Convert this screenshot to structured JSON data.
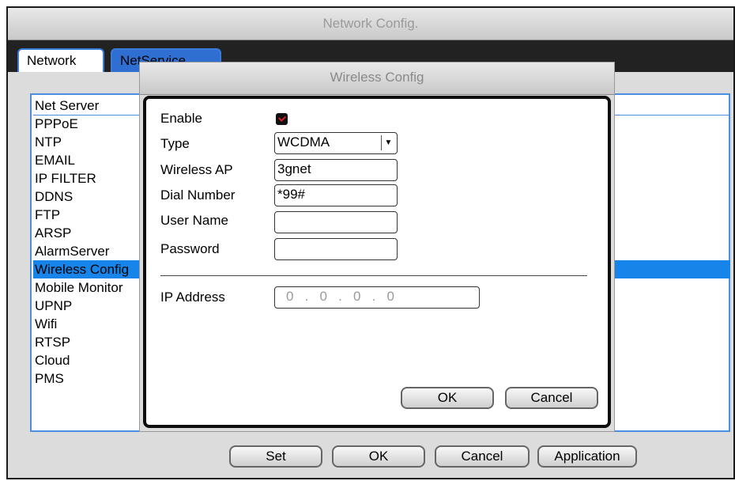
{
  "window": {
    "title": "Network Config."
  },
  "tabs": [
    {
      "label": "Network"
    },
    {
      "label": "NetService"
    }
  ],
  "list": {
    "header": "Net Server",
    "items": [
      "PPPoE",
      "NTP",
      "EMAIL",
      "IP FILTER",
      "DDNS",
      "FTP",
      "ARSP",
      "AlarmServer",
      "Wireless Config",
      "Mobile Monitor",
      "UPNP",
      "Wifi",
      "RTSP",
      "Cloud",
      "PMS"
    ],
    "selected": "Wireless Config"
  },
  "bottom_buttons": {
    "set": "Set",
    "ok": "OK",
    "cancel": "Cancel",
    "application": "Application"
  },
  "dialog": {
    "title": "Wireless Config",
    "enable_label": "Enable",
    "enable_checked": true,
    "type_label": "Type",
    "type_value": "WCDMA",
    "ap_label": "Wireless AP",
    "ap_value": "3gnet",
    "dial_label": "Dial Number",
    "dial_value": "*99#",
    "user_label": "User Name",
    "user_value": "",
    "password_label": "Password",
    "password_value": "",
    "ip_label": "IP Address",
    "ip_value": "0   .   0   .   0   .   0",
    "ok_label": "OK",
    "cancel_label": "Cancel"
  },
  "colors": {
    "selection": "#1684e8",
    "border_blue": "#4a8fe0",
    "checkbox_mark": "#d02020"
  }
}
